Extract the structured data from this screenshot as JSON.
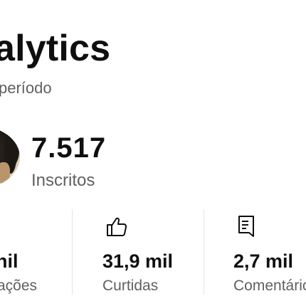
{
  "header": {
    "title": "alytics",
    "subtitle": "período"
  },
  "channel": {
    "subscribers_value": "7.517",
    "subscribers_label": "Inscritos"
  },
  "stats": [
    {
      "icon": "eye-icon",
      "value": "nil",
      "label": "ações"
    },
    {
      "icon": "thumbs-up-icon",
      "value": "31,9 mil",
      "label": "Curtidas"
    },
    {
      "icon": "comment-icon",
      "value": "2,7 mil",
      "label": "Comentáric"
    }
  ],
  "colors": {
    "primary_text": "#0f0f0f",
    "secondary_text": "#606060",
    "divider": "#e5e5e5",
    "background": "#ffffff"
  }
}
